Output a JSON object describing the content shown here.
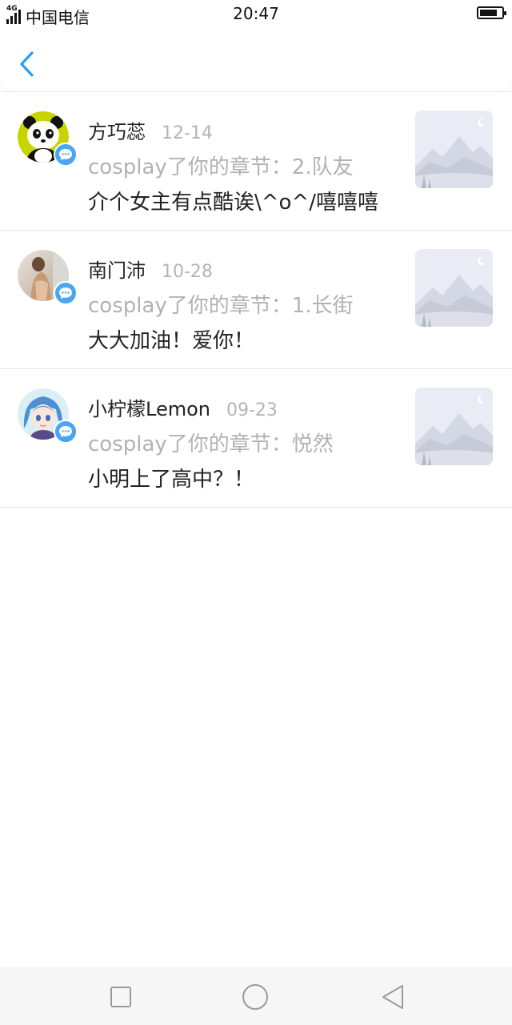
{
  "status_bar": {
    "network": "4G",
    "carrier": "中国电信",
    "time": "20:47",
    "battery_level": 0.8
  },
  "header": {
    "back_icon": "chevron-left-icon",
    "accent_color": "#2a9df4"
  },
  "notifications": [
    {
      "name": "方巧蕊",
      "date": "12-14",
      "action": "cosplay了你的章节：2.队友",
      "comment": "介个女主有点酷诶\\^o^/嘻嘻嘻",
      "avatar_icon": "panda-avatar",
      "badge_icon": "chat-bubble-icon",
      "thumbnail_icon": "mountain-landscape-icon"
    },
    {
      "name": "南门沛",
      "date": "10-28",
      "action": "cosplay了你的章节：1.长街",
      "comment": "大大加油！爱你！",
      "avatar_icon": "photo-avatar",
      "badge_icon": "chat-bubble-icon",
      "thumbnail_icon": "mountain-landscape-icon"
    },
    {
      "name": "小柠檬Lemon",
      "date": "09-23",
      "action": "cosplay了你的章节：悦然",
      "comment": "小明上了高中？！",
      "avatar_icon": "anime-avatar",
      "badge_icon": "chat-bubble-icon",
      "thumbnail_icon": "mountain-landscape-icon"
    }
  ],
  "nav_bar": {
    "recents_icon": "square-icon",
    "home_icon": "circle-icon",
    "back_icon": "triangle-back-icon"
  }
}
